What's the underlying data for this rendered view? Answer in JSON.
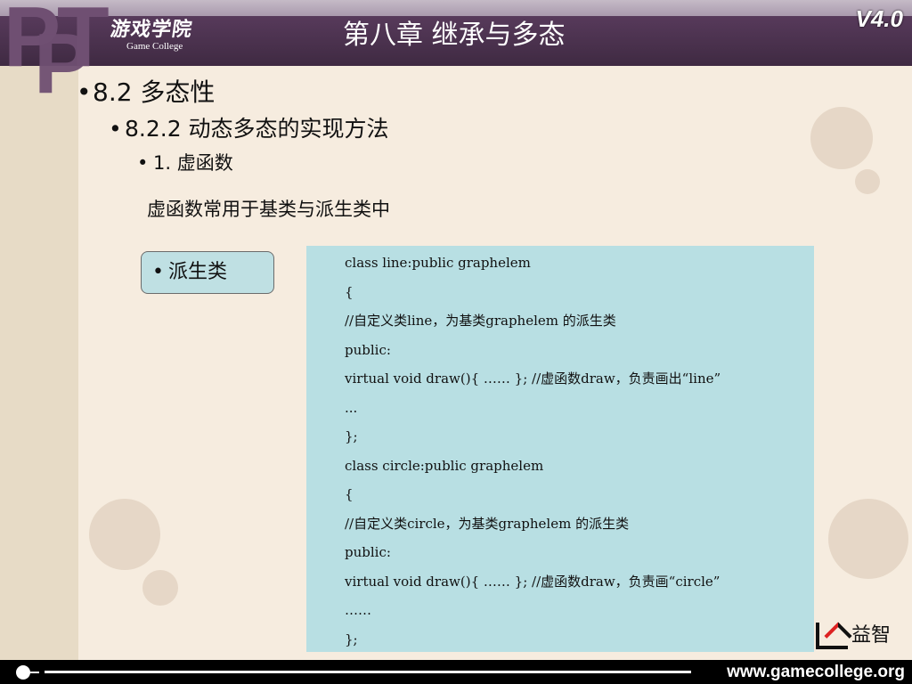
{
  "header": {
    "ppt_text": [
      "P",
      "P",
      "T"
    ],
    "logo_main": "游戏学院",
    "logo_sub": "Game College",
    "title": "第八章 继承与多态",
    "version": "V4.0"
  },
  "bullets": {
    "level1": "8.2  多态性",
    "level2": "8.2.2  动态多态的实现方法",
    "level3": "1. 虚函数",
    "bullet_char": "•"
  },
  "description": "虚函数常用于基类与派生类中",
  "callout": {
    "label": "派生类"
  },
  "code_lines": [
    "class line:public graphelem",
    "{",
    "//自定义类line，为基类graphelem 的派生类",
    "public:",
    "virtual void draw(){ …… }; //虚函数draw，负责画出“line”",
    "...",
    "};",
    "class circle:public graphelem",
    "{",
    "//自定义类circle，为基类graphelem 的派生类",
    "public:",
    "virtual void draw(){ …… }; //虚函数draw，负责画“circle”",
    "……",
    "};"
  ],
  "brand": {
    "name": "益智"
  },
  "footer": {
    "site": "www.gamecollege.org"
  },
  "colors": {
    "header": "#4b334f",
    "code_bg": "#b8dfe3",
    "callout_bg": "#bfe0e3"
  }
}
